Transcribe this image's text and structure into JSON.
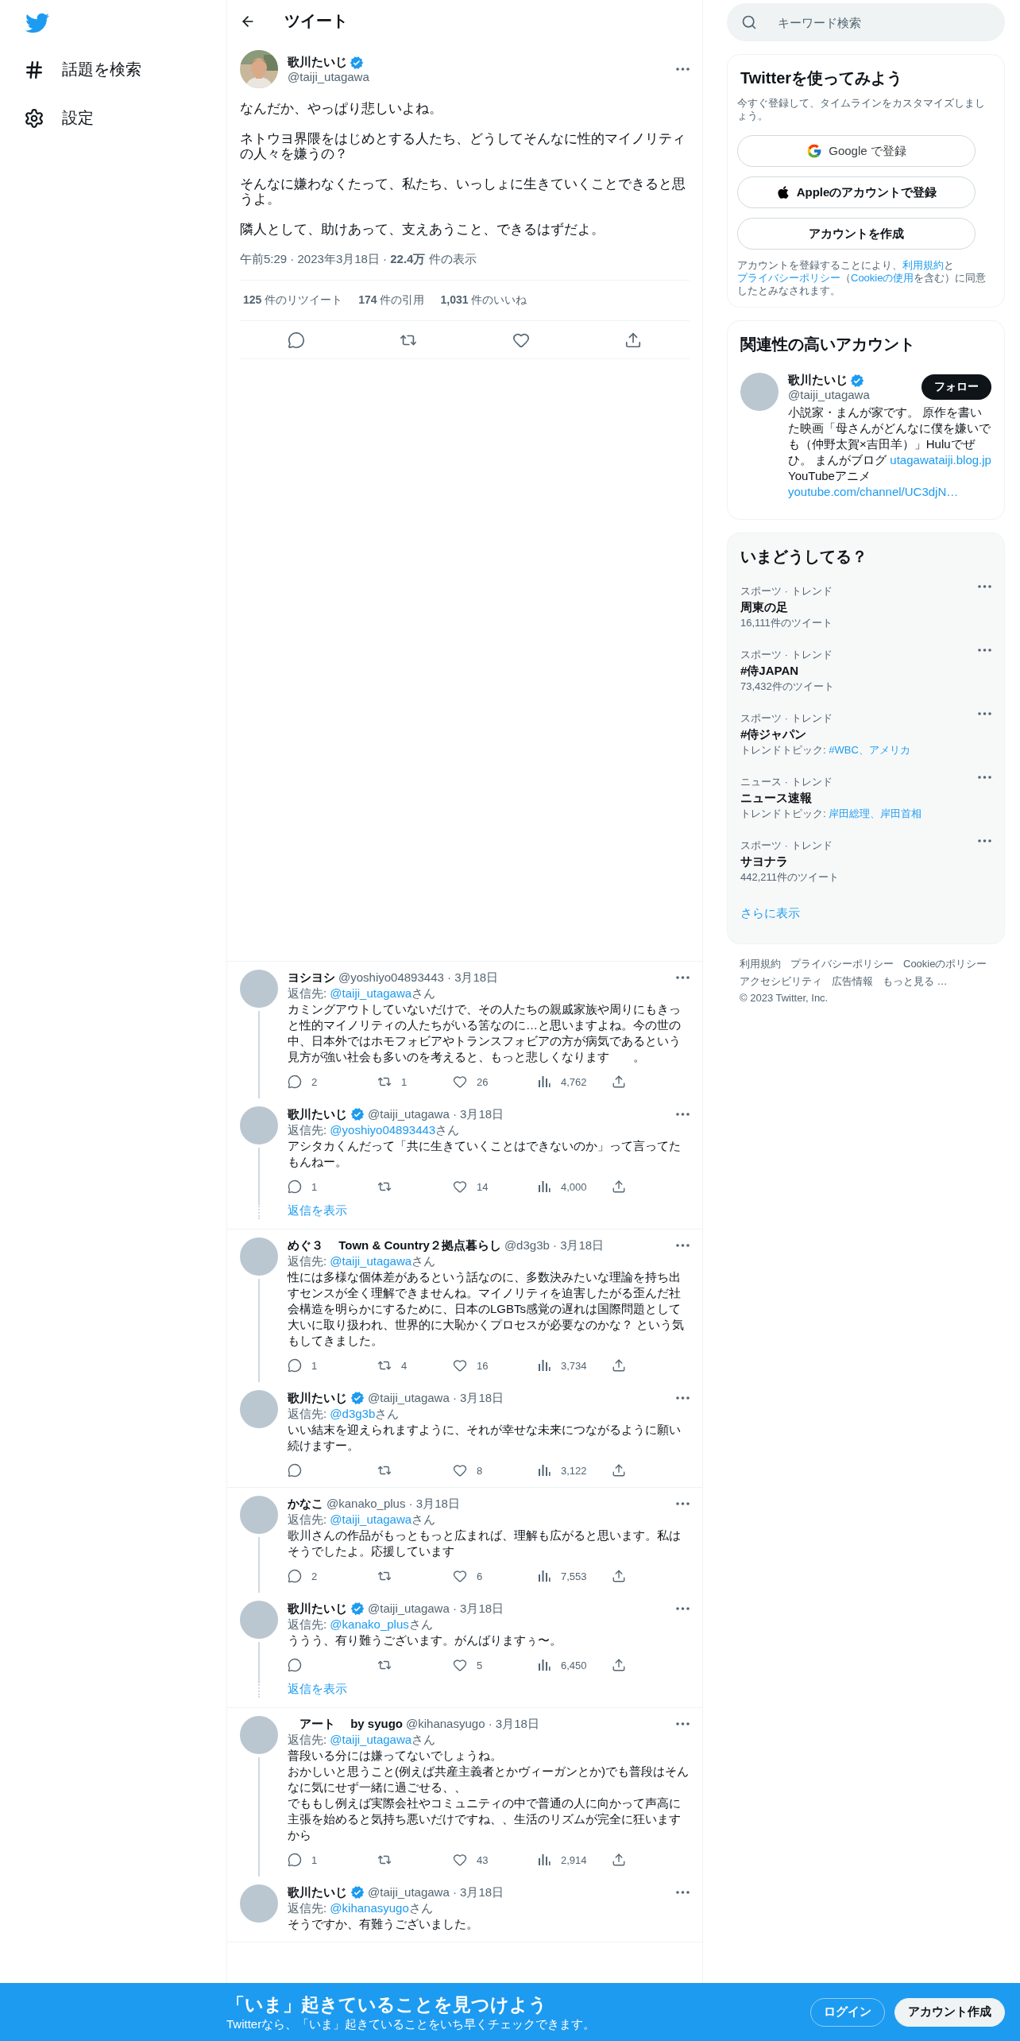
{
  "nav": {
    "items": [
      {
        "kind": "hash",
        "label": "話題を検索"
      },
      {
        "kind": "settings",
        "label": "設定"
      }
    ]
  },
  "header": {
    "title": "ツイート"
  },
  "tweet": {
    "name": "歌川たいじ",
    "verified": true,
    "handle": "@taiji_utagawa",
    "paragraphs": [
      "なんだか、やっぱり悲しいよね。",
      "ネトウヨ界隈をはじめとする人たち、どうしてそんなに性的マイノリティの人々を嫌うの？",
      "そんなに嫌わなくたって、私たち、いっしょに生きていくことできると思うよ。",
      "隣人として、助けあって、支えあうこと、できるはずだよ。"
    ],
    "meta": "午前5:29 · 2023年3月18日 · **22.4万** 件の表示",
    "stats": [
      "**125** 件のリツイート",
      "**174** 件の引用",
      "**1,031** 件のいいね"
    ],
    "actions": [
      {
        "kind": "reply"
      },
      {
        "kind": "retweet"
      },
      {
        "kind": "like"
      },
      {
        "kind": "share"
      }
    ]
  },
  "threads": [
    {
      "tweets": [
        {
          "name": "ヨシヨシ",
          "verified": false,
          "meta": "@yoshiyo04893443 · 3月18日",
          "reply_to": {
            "prefix": "返信先: ",
            "handle": "@taiji_utagawa",
            "suffix": "さん"
          },
          "text": "カミングアウトしていないだけで、その人たちの親戚家族や周りにもきっと性的マイノリティの人たちがいる筈なのに…と思いますよね。今の世の中、日本外ではホモフォビアやトランスフォビアの方が病気であるという見方が強い社会も多いのを考えると、もっと悲しくなります　　。",
          "actions": [
            {
              "kind": "reply",
              "count": "2"
            },
            {
              "kind": "retweet",
              "count": "1"
            },
            {
              "kind": "like",
              "count": "26"
            },
            {
              "kind": "views",
              "count": "4,762"
            },
            {
              "kind": "share"
            }
          ]
        },
        {
          "name": "歌川たいじ",
          "verified": true,
          "meta": "@taiji_utagawa · 3月18日",
          "reply_to": {
            "prefix": "返信先: ",
            "handle": "@yoshiyo04893443",
            "suffix": "さん"
          },
          "text": "アシタカくんだって「共に生きていくことはできないのか」って言ってたもんねー。",
          "actions": [
            {
              "kind": "reply",
              "count": "1"
            },
            {
              "kind": "retweet"
            },
            {
              "kind": "like",
              "count": "14"
            },
            {
              "kind": "views",
              "count": "4,000"
            },
            {
              "kind": "share"
            }
          ]
        }
      ],
      "show_more": "返信を表示"
    },
    {
      "tweets": [
        {
          "name": "めぐ３　 Town & Country２拠点暮らし",
          "verified": false,
          "meta": "@d3g3b · 3月18日",
          "reply_to": {
            "prefix": "返信先: ",
            "handle": "@taiji_utagawa",
            "suffix": "さん"
          },
          "text": "性には多様な個体差があるという話なのに、多数決みたいな理論を持ち出すセンスが全く理解できませんね。マイノリティを迫害したがる歪んだ社会構造を明らかにするために、日本のLGBTs感覚の遅れは国際問題として大いに取り扱われ、世界的に大恥かくプロセスが必要なのかな？ という気もしてきました。",
          "actions": [
            {
              "kind": "reply",
              "count": "1"
            },
            {
              "kind": "retweet",
              "count": "4"
            },
            {
              "kind": "like",
              "count": "16"
            },
            {
              "kind": "views",
              "count": "3,734"
            },
            {
              "kind": "share"
            }
          ]
        },
        {
          "name": "歌川たいじ",
          "verified": true,
          "meta": "@taiji_utagawa · 3月18日",
          "reply_to": {
            "prefix": "返信先: ",
            "handle": "@d3g3b",
            "suffix": "さん"
          },
          "text": "いい結末を迎えられますように、それが幸せな未来につながるように願い続けますー。",
          "actions": [
            {
              "kind": "reply"
            },
            {
              "kind": "retweet"
            },
            {
              "kind": "like",
              "count": "8"
            },
            {
              "kind": "views",
              "count": "3,122"
            },
            {
              "kind": "share"
            }
          ]
        }
      ]
    },
    {
      "tweets": [
        {
          "name": "かなこ",
          "verified": false,
          "meta": "@kanako_plus · 3月18日",
          "reply_to": {
            "prefix": "返信先: ",
            "handle": "@taiji_utagawa",
            "suffix": "さん"
          },
          "text": "歌川さんの作品がもっともっと広まれば、理解も広がると思います。私はそうでしたよ。応援しています",
          "actions": [
            {
              "kind": "reply",
              "count": "2"
            },
            {
              "kind": "retweet"
            },
            {
              "kind": "like",
              "count": "6"
            },
            {
              "kind": "views",
              "count": "7,553"
            },
            {
              "kind": "share"
            }
          ]
        },
        {
          "name": "歌川たいじ",
          "verified": true,
          "meta": "@taiji_utagawa · 3月18日",
          "reply_to": {
            "prefix": "返信先: ",
            "handle": "@kanako_plus",
            "suffix": "さん"
          },
          "text": "ううう、有り難うございます。がんばりますぅ〜。",
          "actions": [
            {
              "kind": "reply"
            },
            {
              "kind": "retweet"
            },
            {
              "kind": "like",
              "count": "5"
            },
            {
              "kind": "views",
              "count": "6,450"
            },
            {
              "kind": "share"
            }
          ]
        }
      ],
      "show_more": "返信を表示"
    },
    {
      "tweets": [
        {
          "name": "　アート　 by syugo",
          "verified": false,
          "meta": "@kihanasyugo · 3月18日",
          "reply_to": {
            "prefix": "返信先: ",
            "handle": "@taiji_utagawa",
            "suffix": "さん"
          },
          "lines": [
            "普段いる分には嫌ってないでしょうね。",
            "おかしいと思うこと(例えば共産主義者とかヴィーガンとか)でも普段はそんなに気にせず一緒に過ごせる、、",
            "でももし例えば実際会社やコミュニティの中で普通の人に向かって声高に主張を始めると気持ち悪いだけですね、、生活のリズムが完全に狂いますから"
          ],
          "actions": [
            {
              "kind": "reply",
              "count": "1"
            },
            {
              "kind": "retweet"
            },
            {
              "kind": "like",
              "count": "43"
            },
            {
              "kind": "views",
              "count": "2,914"
            },
            {
              "kind": "share"
            }
          ]
        },
        {
          "name": "歌川たいじ",
          "verified": true,
          "meta": "@taiji_utagawa · 3月18日",
          "reply_to": {
            "prefix": "返信先: ",
            "handle": "@kihanasyugo",
            "suffix": "さん"
          },
          "text": "そうですか、有難うございました。"
        }
      ]
    }
  ],
  "search": {
    "placeholder": "キーワード検索"
  },
  "signup": {
    "title": "Twitterを使ってみよう",
    "description": "今すぐ登録して、タイムラインをカスタマイズしましょう。",
    "buttons": [
      {
        "kind": "google",
        "label": "Google で登録"
      },
      {
        "kind": "apple",
        "label": "Appleのアカウントで登録"
      },
      {
        "kind": "plain",
        "label": "アカウントを作成"
      }
    ],
    "legal": [
      {
        "text": "アカウントを登録することにより、"
      },
      {
        "text": "利用規約",
        "link": true
      },
      {
        "text": "と"
      },
      {
        "text": "プライバシーポリシー",
        "link": true
      },
      {
        "text": "（"
      },
      {
        "text": "Cookieの使用",
        "link": true
      },
      {
        "text": "を含む）に同意したとみなされます。"
      }
    ]
  },
  "related": {
    "title": "関連性の高いアカウント",
    "name": "歌川たいじ",
    "verified": true,
    "handle": "@taiji_utagawa",
    "follow": "フォロー",
    "bio": [
      {
        "text": "小説家・まんが家です。 原作を書いた映画「母さんがどんなに僕を嫌いでも（仲野太賀×吉田羊）」Huluでぜひ。 まんがブログ "
      },
      {
        "text": "utagawataiji.blog.jp",
        "link": true
      },
      {
        "text": " YouTubeアニメ "
      },
      {
        "text": "youtube.com/channel/UC3djN…",
        "link": true
      }
    ]
  },
  "trends": {
    "title": "いまどうしてる？",
    "more": "さらに表示",
    "items": [
      {
        "category": "スポーツ · トレンド",
        "title": "周東の足",
        "kind": "count",
        "sub": "16,111件のツイート"
      },
      {
        "category": "スポーツ · トレンド",
        "title": "#侍JAPAN",
        "kind": "count",
        "sub": "73,432件のツイート"
      },
      {
        "category": "スポーツ · トレンド",
        "title": "#侍ジャパン",
        "kind": "topics",
        "sub": "トレンドトピック: ",
        "links": "#WBC、アメリカ"
      },
      {
        "category": "ニュース · トレンド",
        "title": "ニュース速報",
        "kind": "topics",
        "sub": "トレンドトピック: ",
        "links": "岸田総理、岸田首相"
      },
      {
        "category": "スポーツ · トレンド",
        "title": "サヨナラ",
        "kind": "count",
        "sub": "442,211件のツイート"
      }
    ]
  },
  "footer": {
    "links": [
      "利用規約",
      "プライバシーポリシー",
      "Cookieのポリシー",
      "アクセシビリティ",
      "広告情報",
      "もっと見る …"
    ],
    "copyright": "© 2023 Twitter, Inc."
  },
  "banner": {
    "title": "「いま」起きていることを見つけよう",
    "subtitle": "Twitterなら、「いま」起きていることをいち早くチェックできます。",
    "login": "ログイン",
    "signup": "アカウント作成"
  }
}
